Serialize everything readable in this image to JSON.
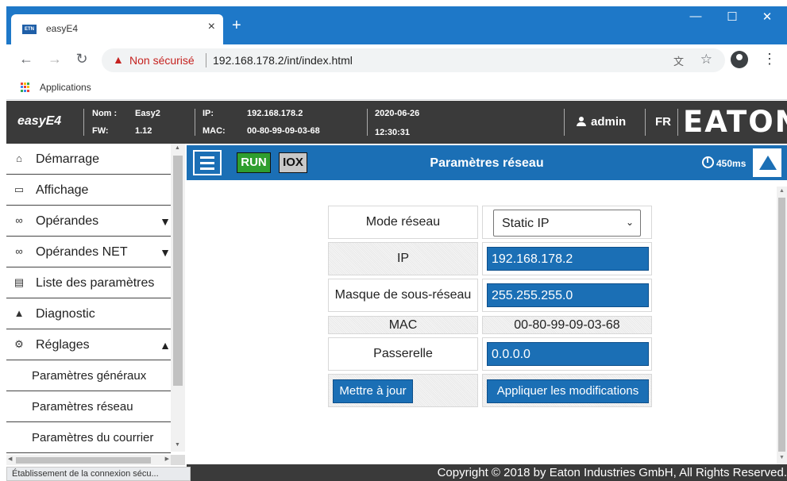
{
  "browser": {
    "tab_title": "easyE4",
    "favicon_text": "ETN",
    "tab_close": "×",
    "new_tab": "+",
    "win_minimize": "—",
    "win_maximize": "☐",
    "win_close": "✕",
    "insecure_label": "Non sécurisé",
    "url": "192.168.178.2/int/index.html",
    "bookmark_apps": "Applications",
    "status_text": "Établissement de la connexion sécu..."
  },
  "header": {
    "app_name": "easyE4",
    "nom_label": "Nom :",
    "nom_value": "Easy2",
    "fw_label": "FW:",
    "fw_value": "1.12",
    "ip_label": "IP:",
    "ip_value": "192.168.178.2",
    "mac_label": "MAC:",
    "mac_value": "00-80-99-09-03-68",
    "date": "2020-06-26",
    "time": "12:30:31",
    "user": "admin",
    "lang": "FR",
    "brand": "EATON",
    "brand_color": "#ffffff"
  },
  "sidebar": {
    "items": [
      {
        "label": "Démarrage",
        "icon": "home-icon",
        "glyph": "⌂"
      },
      {
        "label": "Affichage",
        "icon": "monitor-icon",
        "glyph": "▭"
      },
      {
        "label": "Opérandes",
        "icon": "link-icon",
        "glyph": "∞",
        "arrow": "▼"
      },
      {
        "label": "Opérandes NET",
        "icon": "link-icon",
        "glyph": "∞",
        "arrow": "▼"
      },
      {
        "label": "Liste des paramètres",
        "icon": "list-icon",
        "glyph": "▤"
      },
      {
        "label": "Diagnostic",
        "icon": "warning-icon",
        "glyph": "▲"
      },
      {
        "label": "Réglages",
        "icon": "gear-icon",
        "glyph": "⚙",
        "arrow": "▲"
      }
    ],
    "subitems": [
      {
        "label": "Paramètres généraux"
      },
      {
        "label": "Paramètres réseau"
      },
      {
        "label": "Paramètres du courrier"
      }
    ]
  },
  "toolbar": {
    "status_run": "RUN",
    "status_iox": "IOX",
    "title": "Paramètres réseau",
    "cycle_time": "450ms"
  },
  "network": {
    "mode_label": "Mode réseau",
    "mode_value": "Static IP",
    "ip_label": "IP",
    "ip_value": "192.168.178.2",
    "mask_label": "Masque de sous-réseau",
    "mask_value": "255.255.255.0",
    "mac_label": "MAC",
    "mac_value": "00-80-99-09-03-68",
    "gateway_label": "Passerelle",
    "gateway_value": "0.0.0.0",
    "update_button": "Mettre à jour",
    "apply_button": "Appliquer les modifications"
  },
  "footer": {
    "copyright": "Copyright © 2018 by Eaton Industries GmbH, All Rights Reserved."
  },
  "colors": {
    "accent": "#1b6fb5",
    "run_green": "#2f9e2f",
    "header_dark": "#3a3a3a",
    "chrome_blue": "#1e78c8"
  }
}
